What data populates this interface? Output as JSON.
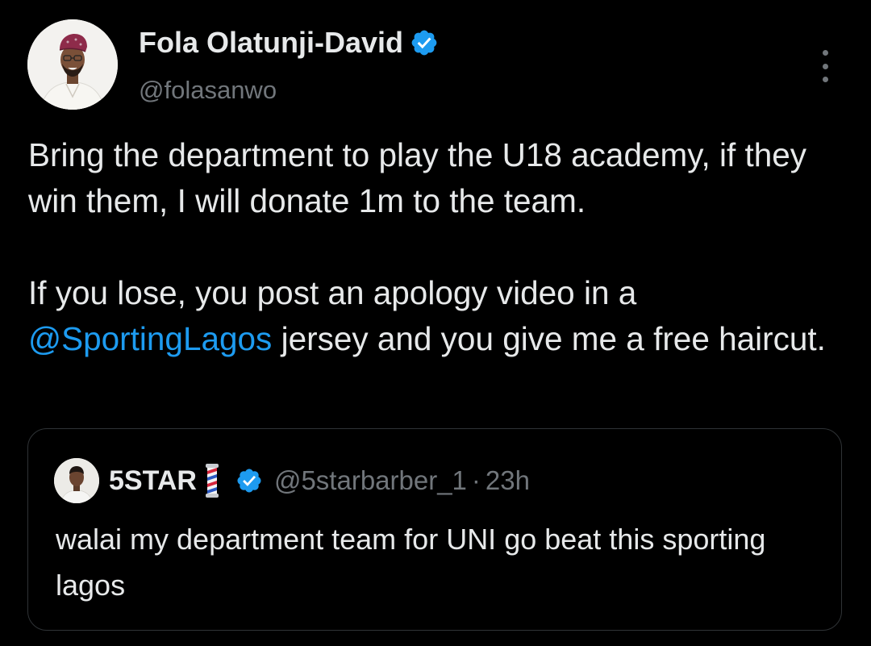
{
  "tweet": {
    "author": {
      "name": "Fola Olatunji-David",
      "handle": "@folasanwo",
      "verified": true,
      "avatar_icon": "profile-photo"
    },
    "body": {
      "paragraph_1": "Bring the department to play the U18 academy, if they win them, I will donate 1m to the team.",
      "paragraph_2_before": "If you lose, you post an apology video in a ",
      "mention": "@SportingLagos",
      "paragraph_2_after": " jersey and you give me a free haircut."
    },
    "more_icon": "ellipsis-vertical-icon"
  },
  "quoted_tweet": {
    "author_name": "5STAR",
    "author_emoji": "barber-pole-icon",
    "verified": true,
    "handle": "@5starbarber_1",
    "separator": "·",
    "time": "23h",
    "text": "walai my department team for UNI go beat this sporting lagos"
  },
  "colors": {
    "background": "#000000",
    "text_primary": "#e7e9ea",
    "text_secondary": "#71767b",
    "accent": "#1d9bf0",
    "border": "#2f3336"
  }
}
